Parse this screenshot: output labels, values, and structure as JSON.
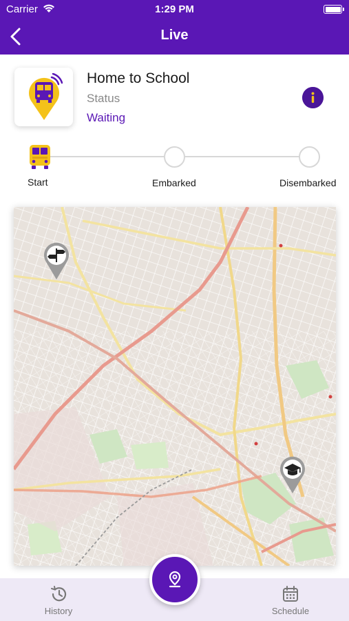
{
  "status_bar": {
    "carrier": "Carrier",
    "time": "1:29 PM"
  },
  "header": {
    "title": "Live"
  },
  "route": {
    "name": "Home to School",
    "status_label": "Status",
    "status_value": "Waiting"
  },
  "progress": {
    "steps": [
      {
        "label": "Start"
      },
      {
        "label": "Embarked"
      },
      {
        "label": "Disembarked"
      }
    ],
    "current_step": 0
  },
  "map": {
    "markers": [
      {
        "type": "start",
        "icon": "signpost-icon"
      },
      {
        "type": "school",
        "icon": "graduation-cap-icon"
      }
    ]
  },
  "nav": {
    "history_label": "History",
    "schedule_label": "Schedule",
    "center_icon": "location-pin-icon"
  },
  "colors": {
    "primary": "#5a17b5",
    "accent": "#f4c21a",
    "nav_bg": "#eee9f6"
  }
}
